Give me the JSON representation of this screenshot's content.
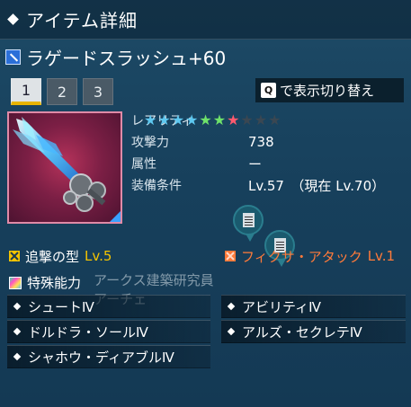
{
  "header": {
    "title": "アイテム詳細"
  },
  "item": {
    "name": "ラゲードスラッシュ+60",
    "type_icon": "sword-icon"
  },
  "tabs": [
    "1",
    "2",
    "3"
  ],
  "toggle": {
    "key": "Q",
    "label": "で表示切り替え"
  },
  "stats": {
    "rarity_label": "レアリティ",
    "rarity_stars": 10,
    "rarity_filled": 7,
    "star_colors": [
      "#5ec8f0",
      "#5ec8f0",
      "#5ec8f0",
      "#5ec8f0",
      "#6fe36a",
      "#6fe36a",
      "#ff5a6e",
      "#3a4752",
      "#3a4752",
      "#3a4752"
    ],
    "attack_label": "攻撃力",
    "attack_value": "738",
    "element_label": "属性",
    "element_value": "ー",
    "req_label": "装備条件",
    "req_value": "Lv.57　（現在 Lv.70）"
  },
  "abilities": {
    "left_name": "追撃の型",
    "left_level": "Lv.5",
    "right_name": "フィクサ・アタック",
    "right_level": "Lv.1"
  },
  "special": {
    "label": "特殊能力",
    "overlay_line1": "アークス建築研究員",
    "overlay_line2": "アーチェ",
    "caps": [
      "シュートⅣ",
      "アビリティⅣ",
      "ドルドラ・ソールⅣ",
      "アルズ・セクレテⅣ",
      "シャホウ・ディアブルⅣ"
    ]
  },
  "colors": {
    "accent_yellow": "#f5c400",
    "accent_orange": "#ff7a3a",
    "panel_border": "#e08aa7"
  }
}
